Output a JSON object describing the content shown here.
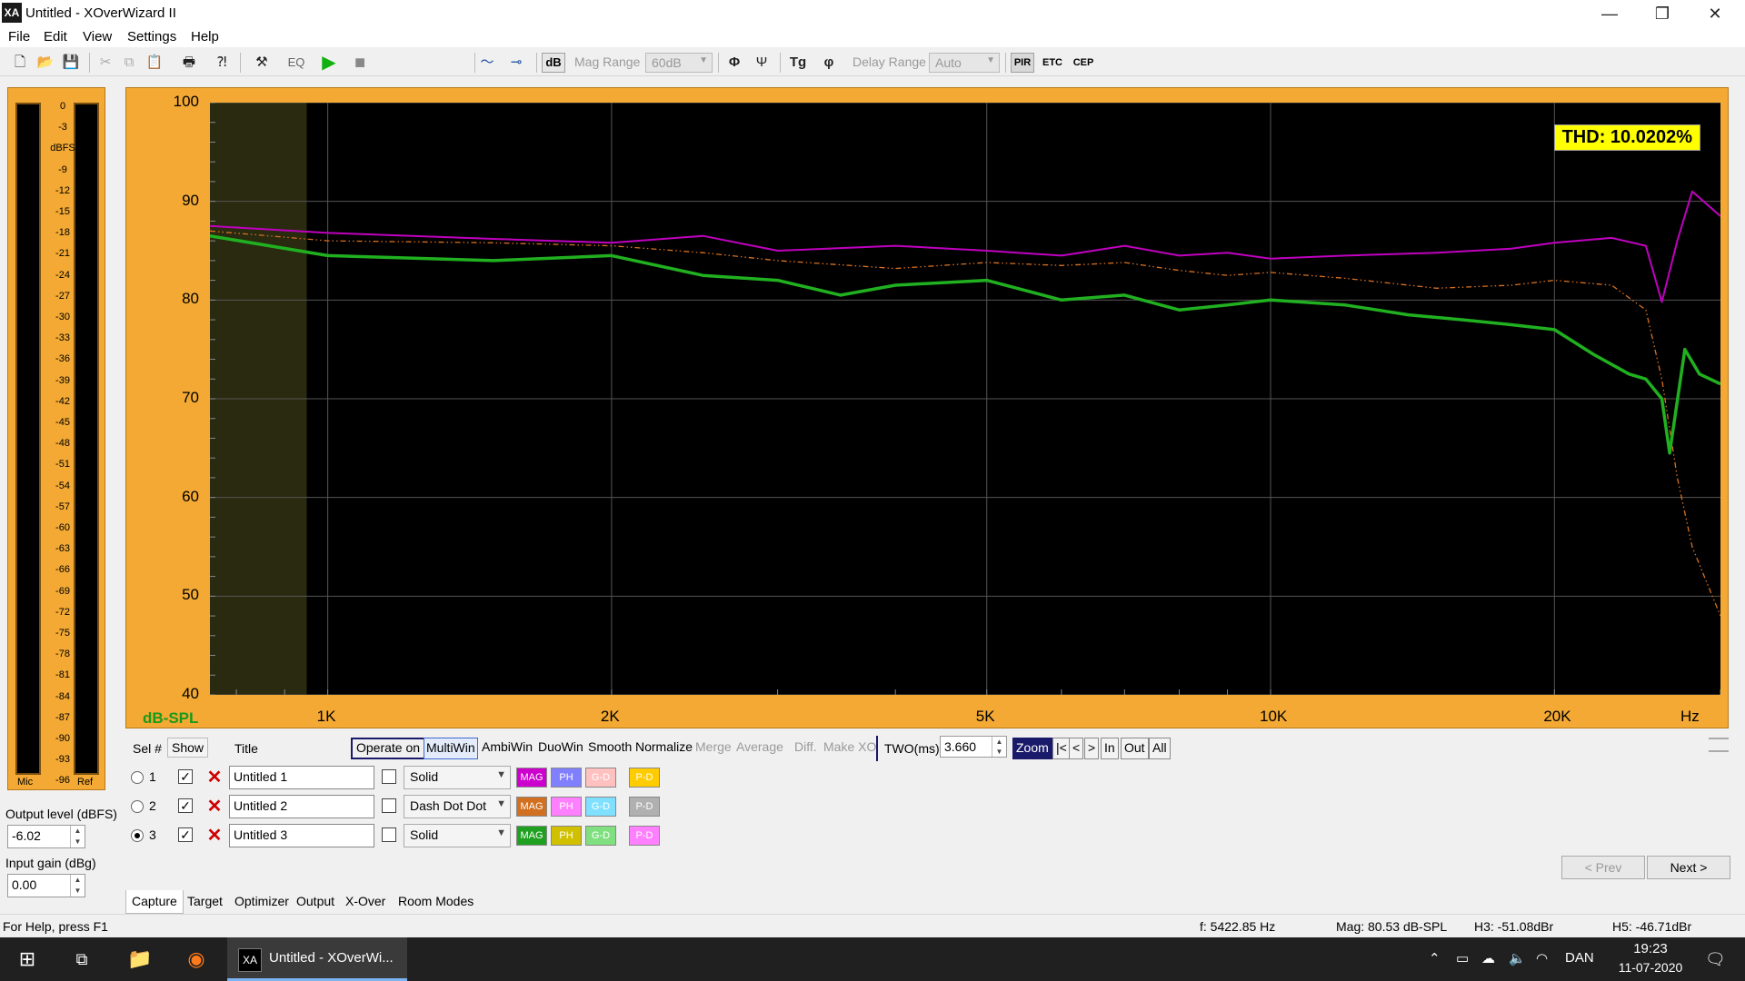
{
  "window": {
    "title": "Untitled - XOverWizard II",
    "app_icon_text": "XA",
    "minimize": "—",
    "maximize": "❐",
    "close": "✕"
  },
  "menu": [
    "File",
    "Edit",
    "View",
    "Settings",
    "Help"
  ],
  "toolbar": {
    "eq_label": "EQ",
    "db_label": "dB",
    "mag_range_label": "Mag Range",
    "mag_range_value": "60dB",
    "delay_range_label": "Delay Range",
    "delay_range_value": "Auto",
    "pir_label": "PIR",
    "etc_label": "ETC",
    "cep_label": "CEP"
  },
  "meter": {
    "ticks": [
      "0",
      "-3",
      "dBFS",
      "-9",
      "-12",
      "-15",
      "-18",
      "-21",
      "-24",
      "-27",
      "-30",
      "-33",
      "-36",
      "-39",
      "-42",
      "-45",
      "-48",
      "-51",
      "-54",
      "-57",
      "-60",
      "-63",
      "-66",
      "-69",
      "-72",
      "-75",
      "-78",
      "-81",
      "-84",
      "-87",
      "-90",
      "-93",
      "-96"
    ],
    "mic_label": "Mic",
    "ref_label": "Ref"
  },
  "output_level": {
    "label": "Output level (dBFS)",
    "value": "-6.02"
  },
  "input_gain": {
    "label": "Input gain (dBg)",
    "value": "0.00"
  },
  "graph": {
    "thd": "THD: 10.0202%",
    "unit_label": "dB-SPL",
    "hz_label": "Hz",
    "y_ticks": [
      "100",
      "90",
      "80",
      "70",
      "60",
      "50",
      "40"
    ],
    "x_ticks": [
      "1K",
      "2K",
      "5K",
      "10K",
      "20K"
    ]
  },
  "chart_data": {
    "type": "line",
    "title": "",
    "xlabel": "Hz",
    "ylabel": "dB-SPL",
    "x_scale": "log",
    "xlim": [
      750,
      30000
    ],
    "ylim": [
      40,
      100
    ],
    "grid": true,
    "annotation": "THD: 10.0202%",
    "series": [
      {
        "name": "Untitled 1",
        "color": "#c000c0",
        "style": "solid",
        "x": [
          750,
          1000,
          1500,
          2000,
          2500,
          3000,
          4000,
          5000,
          6000,
          7000,
          8000,
          9000,
          10000,
          12000,
          15000,
          18000,
          20000,
          23000,
          25000,
          26000,
          27000,
          28000,
          30000
        ],
        "y": [
          87.5,
          86.8,
          86.2,
          85.8,
          86.5,
          85.0,
          85.5,
          85.0,
          84.5,
          85.5,
          84.5,
          84.8,
          84.2,
          84.5,
          84.8,
          85.2,
          85.8,
          86.3,
          85.5,
          79.8,
          86.0,
          91.0,
          88.5
        ]
      },
      {
        "name": "Untitled 2",
        "color": "#d87020",
        "style": "Dash Dot Dot",
        "x": [
          750,
          1000,
          1500,
          2000,
          2500,
          3000,
          4000,
          5000,
          6000,
          7000,
          8000,
          9000,
          10000,
          12000,
          15000,
          18000,
          20000,
          23000,
          25000,
          26000,
          27000,
          28000,
          30000
        ],
        "y": [
          87.0,
          86.0,
          85.8,
          85.5,
          84.8,
          84.0,
          83.2,
          83.8,
          83.5,
          83.8,
          83.0,
          82.5,
          82.8,
          82.2,
          81.2,
          81.5,
          82.0,
          81.5,
          79.0,
          72.0,
          62.0,
          55.0,
          48.0
        ]
      },
      {
        "name": "Untitled 3",
        "color": "#20b020",
        "style": "solid",
        "x": [
          750,
          1000,
          1500,
          2000,
          2500,
          3000,
          3500,
          4000,
          5000,
          6000,
          7000,
          8000,
          9000,
          10000,
          12000,
          14000,
          16000,
          18000,
          20000,
          22000,
          24000,
          25000,
          26000,
          26500,
          27500,
          28500,
          30000
        ],
        "y": [
          86.5,
          84.5,
          84.0,
          84.5,
          82.5,
          82.0,
          80.5,
          81.5,
          82.0,
          80.0,
          80.5,
          79.0,
          79.5,
          80.0,
          79.5,
          78.5,
          78.0,
          77.5,
          77.0,
          74.5,
          72.5,
          72.0,
          70.0,
          64.5,
          75.0,
          72.5,
          71.5
        ]
      }
    ]
  },
  "controls": {
    "sel_label": "Sel #",
    "show_label": "Show",
    "title_label": "Title",
    "operate_on": "Operate on",
    "ops": [
      "MultiWin",
      "AmbiWin",
      "DuoWin",
      "Smooth",
      "Normalize"
    ],
    "ops_disabled": [
      "Merge",
      "Average",
      "Diff.",
      "Make XO"
    ],
    "two_label": "TWO(ms)",
    "two_value": "3.660",
    "zoom": "Zoom",
    "zoom_buttons": [
      "|<",
      "<",
      ">",
      "In",
      "Out",
      "All"
    ]
  },
  "traces": [
    {
      "num": "1",
      "title": "Untitled 1",
      "style": "Solid",
      "selected": false,
      "colors": {
        "MAG": "#cc00cc",
        "PH": "#8080ff",
        "G-D": "#ffc0c0",
        "P-D": "#ffcc00"
      }
    },
    {
      "num": "2",
      "title": "Untitled 2",
      "style": "Dash Dot Dot",
      "selected": false,
      "colors": {
        "MAG": "#d07020",
        "PH": "#ff80ff",
        "G-D": "#80e0ff",
        "P-D": "#b0b0b0"
      }
    },
    {
      "num": "3",
      "title": "Untitled 3",
      "style": "Solid",
      "selected": true,
      "colors": {
        "MAG": "#20a020",
        "PH": "#d0c000",
        "G-D": "#80e080",
        "P-D": "#ff80ff"
      }
    }
  ],
  "trace_button_labels": [
    "MAG",
    "PH",
    "G-D",
    "P-D"
  ],
  "nav": {
    "prev": "< Prev",
    "next": "Next >"
  },
  "tabs": [
    "Capture",
    "Target",
    "Optimizer",
    "Output",
    "X-Over",
    "Room Modes"
  ],
  "status": {
    "help": "For Help, press F1",
    "freq": "f: 5422.85 Hz",
    "mag": "Mag: 80.53 dB-SPL",
    "h3": "H3: -51.08dBr",
    "h5": "H5: -46.71dBr"
  },
  "taskbar": {
    "app_label": "Untitled - XOverWi...",
    "lang": "DAN",
    "time": "19:23",
    "date": "11-07-2020"
  }
}
